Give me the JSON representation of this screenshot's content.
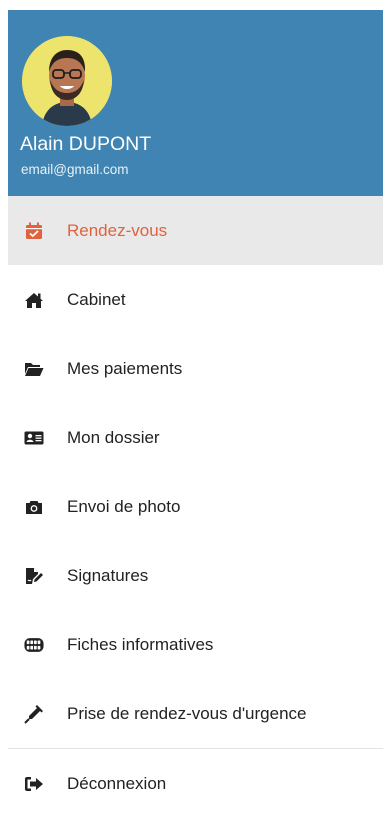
{
  "profile": {
    "name": "Alain DUPONT",
    "email": "email@gmail.com",
    "avatar_bg": "#ede46d"
  },
  "colors": {
    "header": "#3f84b2",
    "active_accent": "#e0623f",
    "active_bg": "#e9e9ea"
  },
  "menu": {
    "items": [
      {
        "label": "Rendez-vous",
        "icon": "calendar-check-icon",
        "active": true
      },
      {
        "label": "Cabinet",
        "icon": "home-icon"
      },
      {
        "label": "Mes paiements",
        "icon": "folder-open-icon"
      },
      {
        "label": "Mon dossier",
        "icon": "id-card-icon"
      },
      {
        "label": "Envoi de photo",
        "icon": "camera-icon"
      },
      {
        "label": "Signatures",
        "icon": "file-signature-icon"
      },
      {
        "label": "Fiches informatives",
        "icon": "teeth-icon"
      },
      {
        "label": "Prise de rendez-vous d'urgence",
        "icon": "syringe-icon"
      }
    ],
    "logout": {
      "label": "Déconnexion",
      "icon": "sign-out-icon"
    }
  }
}
